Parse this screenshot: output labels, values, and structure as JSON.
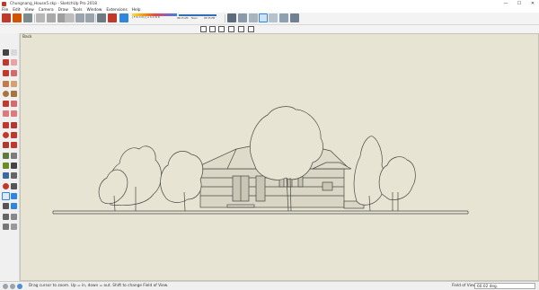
{
  "window": {
    "title": "Chungnang_House5.skp - SketchUp Pro 2018",
    "minimize_glyph": "—",
    "maximize_glyph": "☐",
    "close_glyph": "✕"
  },
  "menu": {
    "items": [
      "File",
      "Edit",
      "View",
      "Camera",
      "Draw",
      "Tools",
      "Window",
      "Extensions",
      "Help"
    ]
  },
  "shadows": {
    "months": "J F M A M J J A S O N D",
    "time_start": "06:15 AM",
    "time_noon": "Noon",
    "time_end": "05:35 PM"
  },
  "viewport": {
    "scene_label": "Back",
    "background_color": "#e7e4d4",
    "line_color": "#4a4a44"
  },
  "status": {
    "hint": "Drag cursor to zoom.  Up = in, down = out. Shift to change Field of View.",
    "vcb_label": "Field of View",
    "vcb_value": "60.02 deg."
  }
}
